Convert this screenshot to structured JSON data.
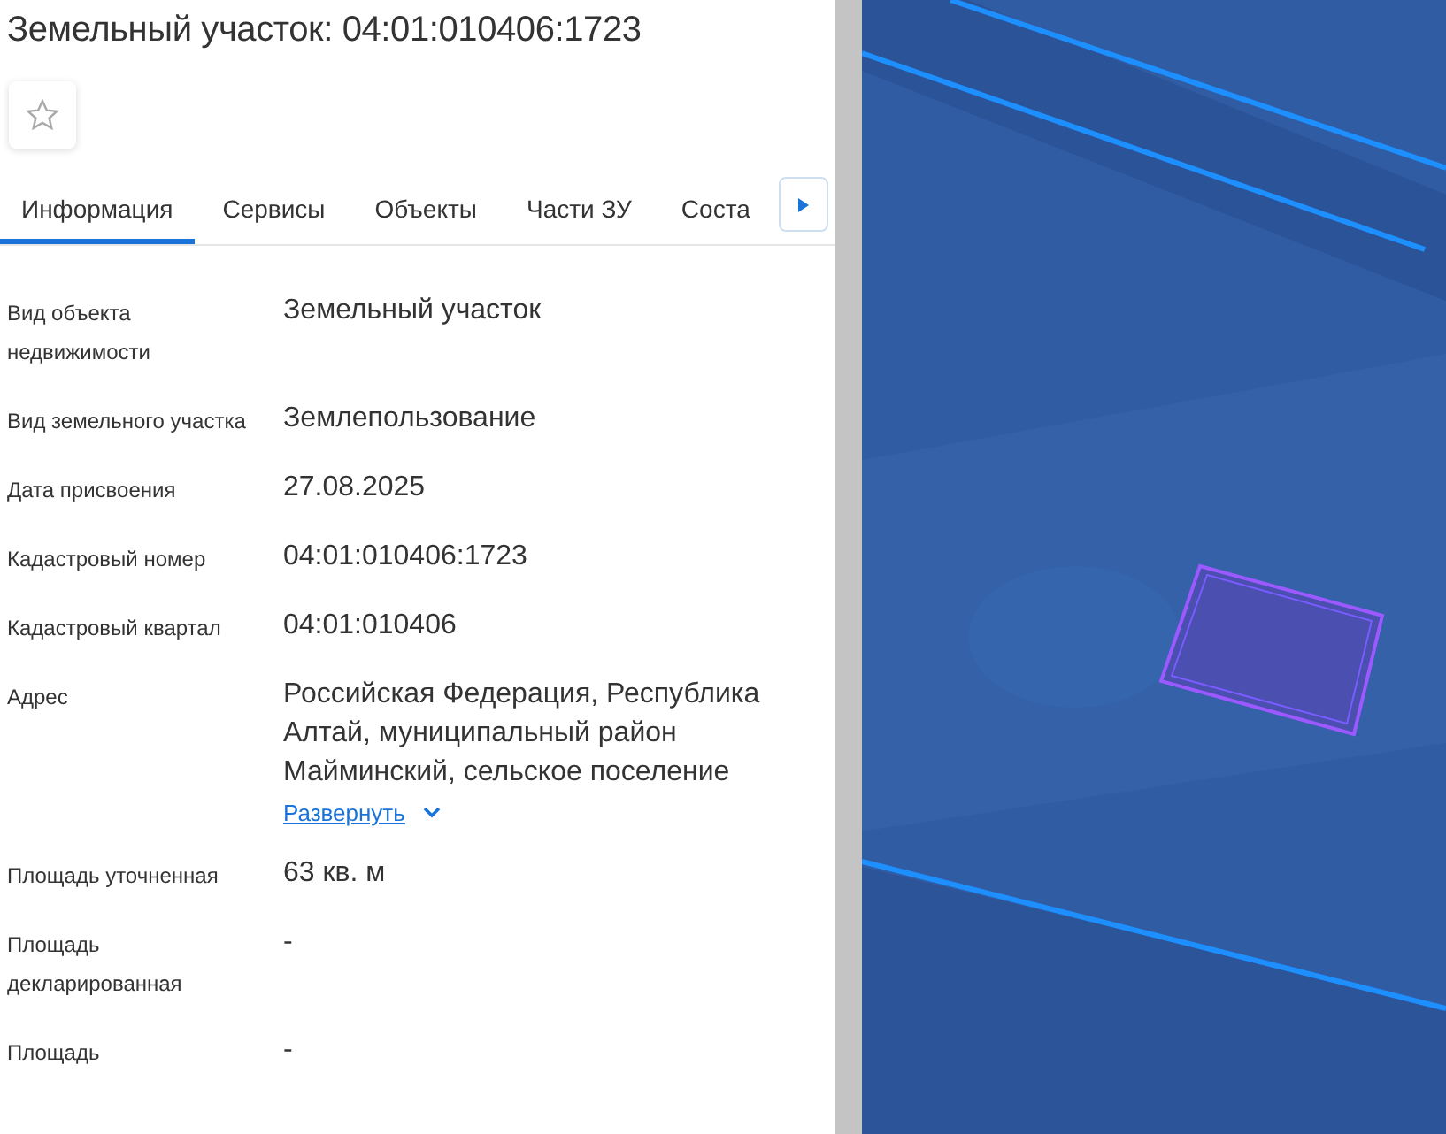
{
  "title": "Земельный участок: 04:01:010406:1723",
  "favorite": {
    "on": false
  },
  "tabs": [
    {
      "label": "Информация",
      "selected": true
    },
    {
      "label": "Сервисы",
      "selected": false
    },
    {
      "label": "Объекты",
      "selected": false
    },
    {
      "label": "Части ЗУ",
      "selected": false
    },
    {
      "label": "Соста",
      "selected": false
    }
  ],
  "fields": [
    {
      "label": "Вид объекта недвижимости",
      "value": "Земельный участок"
    },
    {
      "label": "Вид земельного участка",
      "value": "Землепользование"
    },
    {
      "label": "Дата присвоения",
      "value": "27.08.2025"
    },
    {
      "label": "Кадастровый номер",
      "value": "04:01:010406:1723"
    },
    {
      "label": "Кадастровый квартал",
      "value": "04:01:010406"
    },
    {
      "label": "Адрес",
      "value": "Российская Федерация, Республика Алтай, муниципальный район Майминский, сельское поселение",
      "link": "Развернуть"
    },
    {
      "label": "Площадь уточненная",
      "value": "63 кв. м"
    },
    {
      "label": "Площадь декларированная",
      "value": "-"
    },
    {
      "label": "Площадь",
      "value": "-"
    }
  ]
}
